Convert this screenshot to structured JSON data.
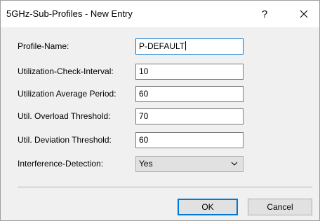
{
  "window": {
    "title": "5GHz-Sub-Profiles - New Entry",
    "help_label": "?",
    "close_label": "close"
  },
  "form": {
    "fields": [
      {
        "label": "Profile-Name:",
        "value": "P-DEFAULT"
      },
      {
        "label": "Utilization-Check-Interval:",
        "value": "10"
      },
      {
        "label": "Utilization Average Period:",
        "value": "60"
      },
      {
        "label": "Util. Overload Threshold:",
        "value": "70"
      },
      {
        "label": "Util. Deviation Threshold:",
        "value": "60"
      },
      {
        "label": "Interference-Detection:",
        "value": "Yes"
      }
    ]
  },
  "buttons": {
    "ok": "OK",
    "cancel": "Cancel"
  },
  "colors": {
    "focus_border": "#0078d7",
    "dialog_background": "#f0f0f0",
    "titlebar_background": "#ffffff"
  },
  "icons": {
    "close": "close-icon",
    "dropdown": "chevron-down-icon"
  }
}
